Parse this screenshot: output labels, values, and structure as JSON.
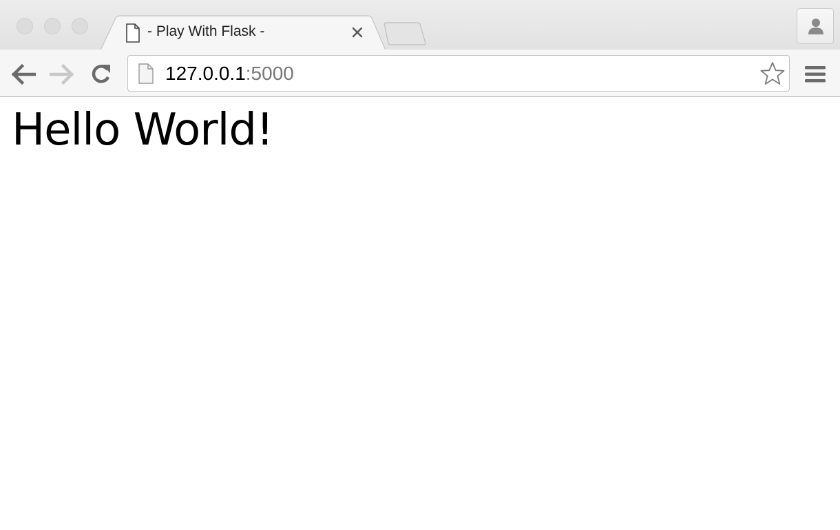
{
  "tab": {
    "title": "- Play With Flask -",
    "icon": "page-icon",
    "close_icon": "close-icon"
  },
  "toolbar": {
    "back_icon": "back-arrow-icon",
    "forward_icon": "forward-arrow-icon",
    "reload_icon": "reload-icon",
    "menu_icon": "hamburger-menu-icon",
    "bookmark_icon": "star-icon"
  },
  "address_bar": {
    "host": "127.0.0.1",
    "port": ":5000"
  },
  "page": {
    "heading": "Hello World!"
  },
  "colors": {
    "url_host": "#000000",
    "url_port": "#777777",
    "toolbar_bg": "#f6f6f6",
    "tabstrip_bg": "#e6e6e6"
  }
}
